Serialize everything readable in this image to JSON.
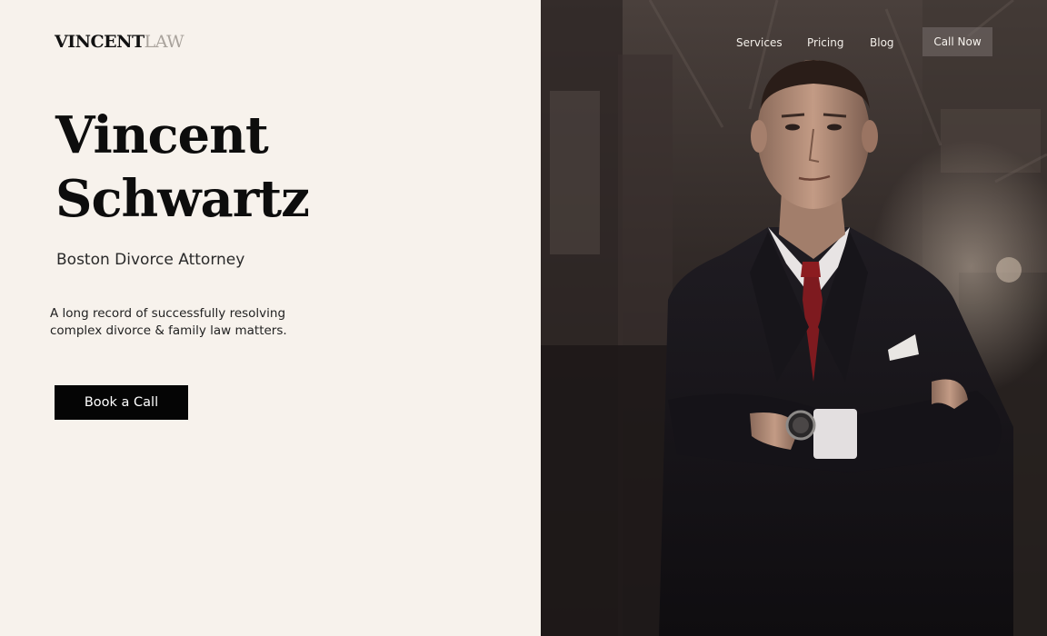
{
  "header": {
    "logo_bold": "VINCENT",
    "logo_light": "LAW",
    "nav": [
      {
        "label": "Services"
      },
      {
        "label": "Pricing"
      },
      {
        "label": "Blog"
      }
    ],
    "call_button": "Call Now"
  },
  "hero": {
    "name_line1": "Vincent",
    "name_line2": "Schwartz",
    "subtitle": "Boston Divorce Attorney",
    "description_line1": "A long record of successfully resolving",
    "description_line2": "complex divorce & family law matters.",
    "cta_label": "Book a Call"
  },
  "photo": {
    "subject": "attorney-portrait"
  },
  "colors": {
    "background": "#f7f2ec",
    "text": "#111111",
    "logo_light": "#a9a39c",
    "button_bg": "#050505",
    "tie": "#8c1c20"
  }
}
